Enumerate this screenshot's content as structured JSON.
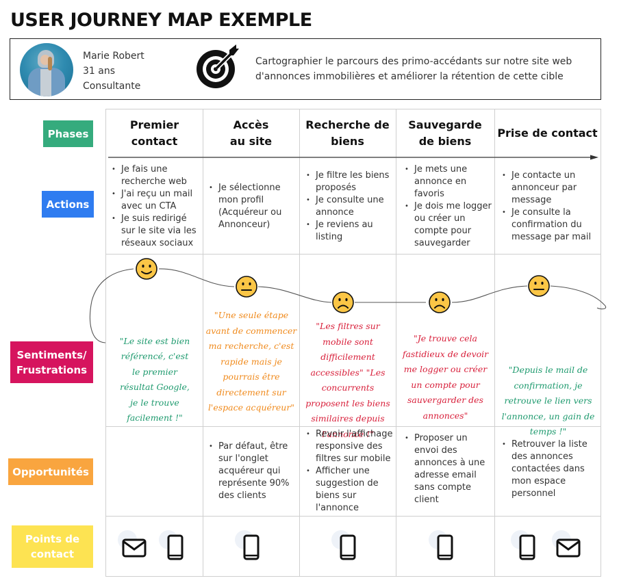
{
  "title": "USER JOURNEY MAP EXEMPLE",
  "persona": {
    "avatar": "persona-photo",
    "name": "Marie Robert",
    "age": "31 ans",
    "job": "Consultante"
  },
  "goal": {
    "icon": "target-icon",
    "line1": "Cartographier le parcours des primo-accédants sur notre site web",
    "line2": "d'annonces immobilières et améliorer la rétention de cette cible"
  },
  "row_labels": {
    "phases": {
      "label": "Phases",
      "color": "#35ab7d"
    },
    "actions": {
      "label": "Actions",
      "color": "#2f7cf0"
    },
    "sentiments": {
      "line1": "Sentiments/",
      "line2": "Frustrations",
      "color": "#d6145e"
    },
    "opportunities": {
      "label": "Opportunités",
      "color": "#f9a53f"
    },
    "touchpoints": {
      "line1": "Points de",
      "line2": "contact",
      "color": "#fde352"
    }
  },
  "phases": [
    {
      "line1": "Premier",
      "line2": "contact"
    },
    {
      "line1": "Accès",
      "line2": "au site"
    },
    {
      "line1": "Recherche de",
      "line2": "biens"
    },
    {
      "line1": "Sauvegarde",
      "line2": "de biens"
    },
    {
      "line1": "Prise de contact",
      "line2": ""
    }
  ],
  "actions": [
    [
      "Je fais une recherche web",
      "J'ai reçu un mail avec un CTA",
      "Je suis redirigé sur le site via les réseaux sociaux"
    ],
    [
      "Je sélectionne mon profil (Acquéreur ou Annonceur)"
    ],
    [
      "Je filtre les biens proposés",
      "Je consulte une annonce",
      "Je reviens au listing"
    ],
    [
      "Je mets une annonce en favoris",
      "Je dois me logger ou créer un compte pour sauvegarder"
    ],
    [
      "Je contacte un annonceur par message",
      "Je consulte la confirmation du message par mail"
    ]
  ],
  "sentiments": [
    {
      "mood": "happy",
      "quote": "\"Le site est bien référencé, c'est le premier résultat Google, je le trouve facilement !\"",
      "color": "#1e9a6e"
    },
    {
      "mood": "neutral",
      "quote": "\"Une seule étape avant de commencer ma recherche, c'est rapide mais je pourrais être directement sur l'espace acquéreur\"",
      "color": "#f08a1c"
    },
    {
      "mood": "sad",
      "quote": "\"Les filtres sur mobile sont difficilement accessibles\" \"Les concurrents proposent les biens similaires depuis l'annonce !\"",
      "color": "#d81f3a"
    },
    {
      "mood": "sad",
      "quote": "\"Je trouve cela fastidieux de devoir me logger ou créer un compte pour sauvergarder des annonces\"",
      "color": "#d81f3a"
    },
    {
      "mood": "neutral",
      "quote": "\"Depuis le mail de confirmation, je retrouve le lien vers l'annonce, un gain de temps !\"",
      "color": "#1e9a6e"
    }
  ],
  "opportunities": [
    [],
    [
      "Par défaut, être sur l'onglet acquéreur qui représente 90% des clients"
    ],
    [
      "Revoir l'affichage responsive des filtres sur mobile",
      "Afficher une suggestion de biens sur l'annonce"
    ],
    [
      "Proposer un envoi des annonces à une adresse email sans compte client"
    ],
    [
      "Retrouver la liste des annonces contactées dans mon espace personnel"
    ]
  ],
  "touchpoints": [
    [
      "email",
      "mobile"
    ],
    [
      "mobile"
    ],
    [
      "mobile"
    ],
    [
      "mobile"
    ],
    [
      "mobile",
      "email"
    ]
  ]
}
